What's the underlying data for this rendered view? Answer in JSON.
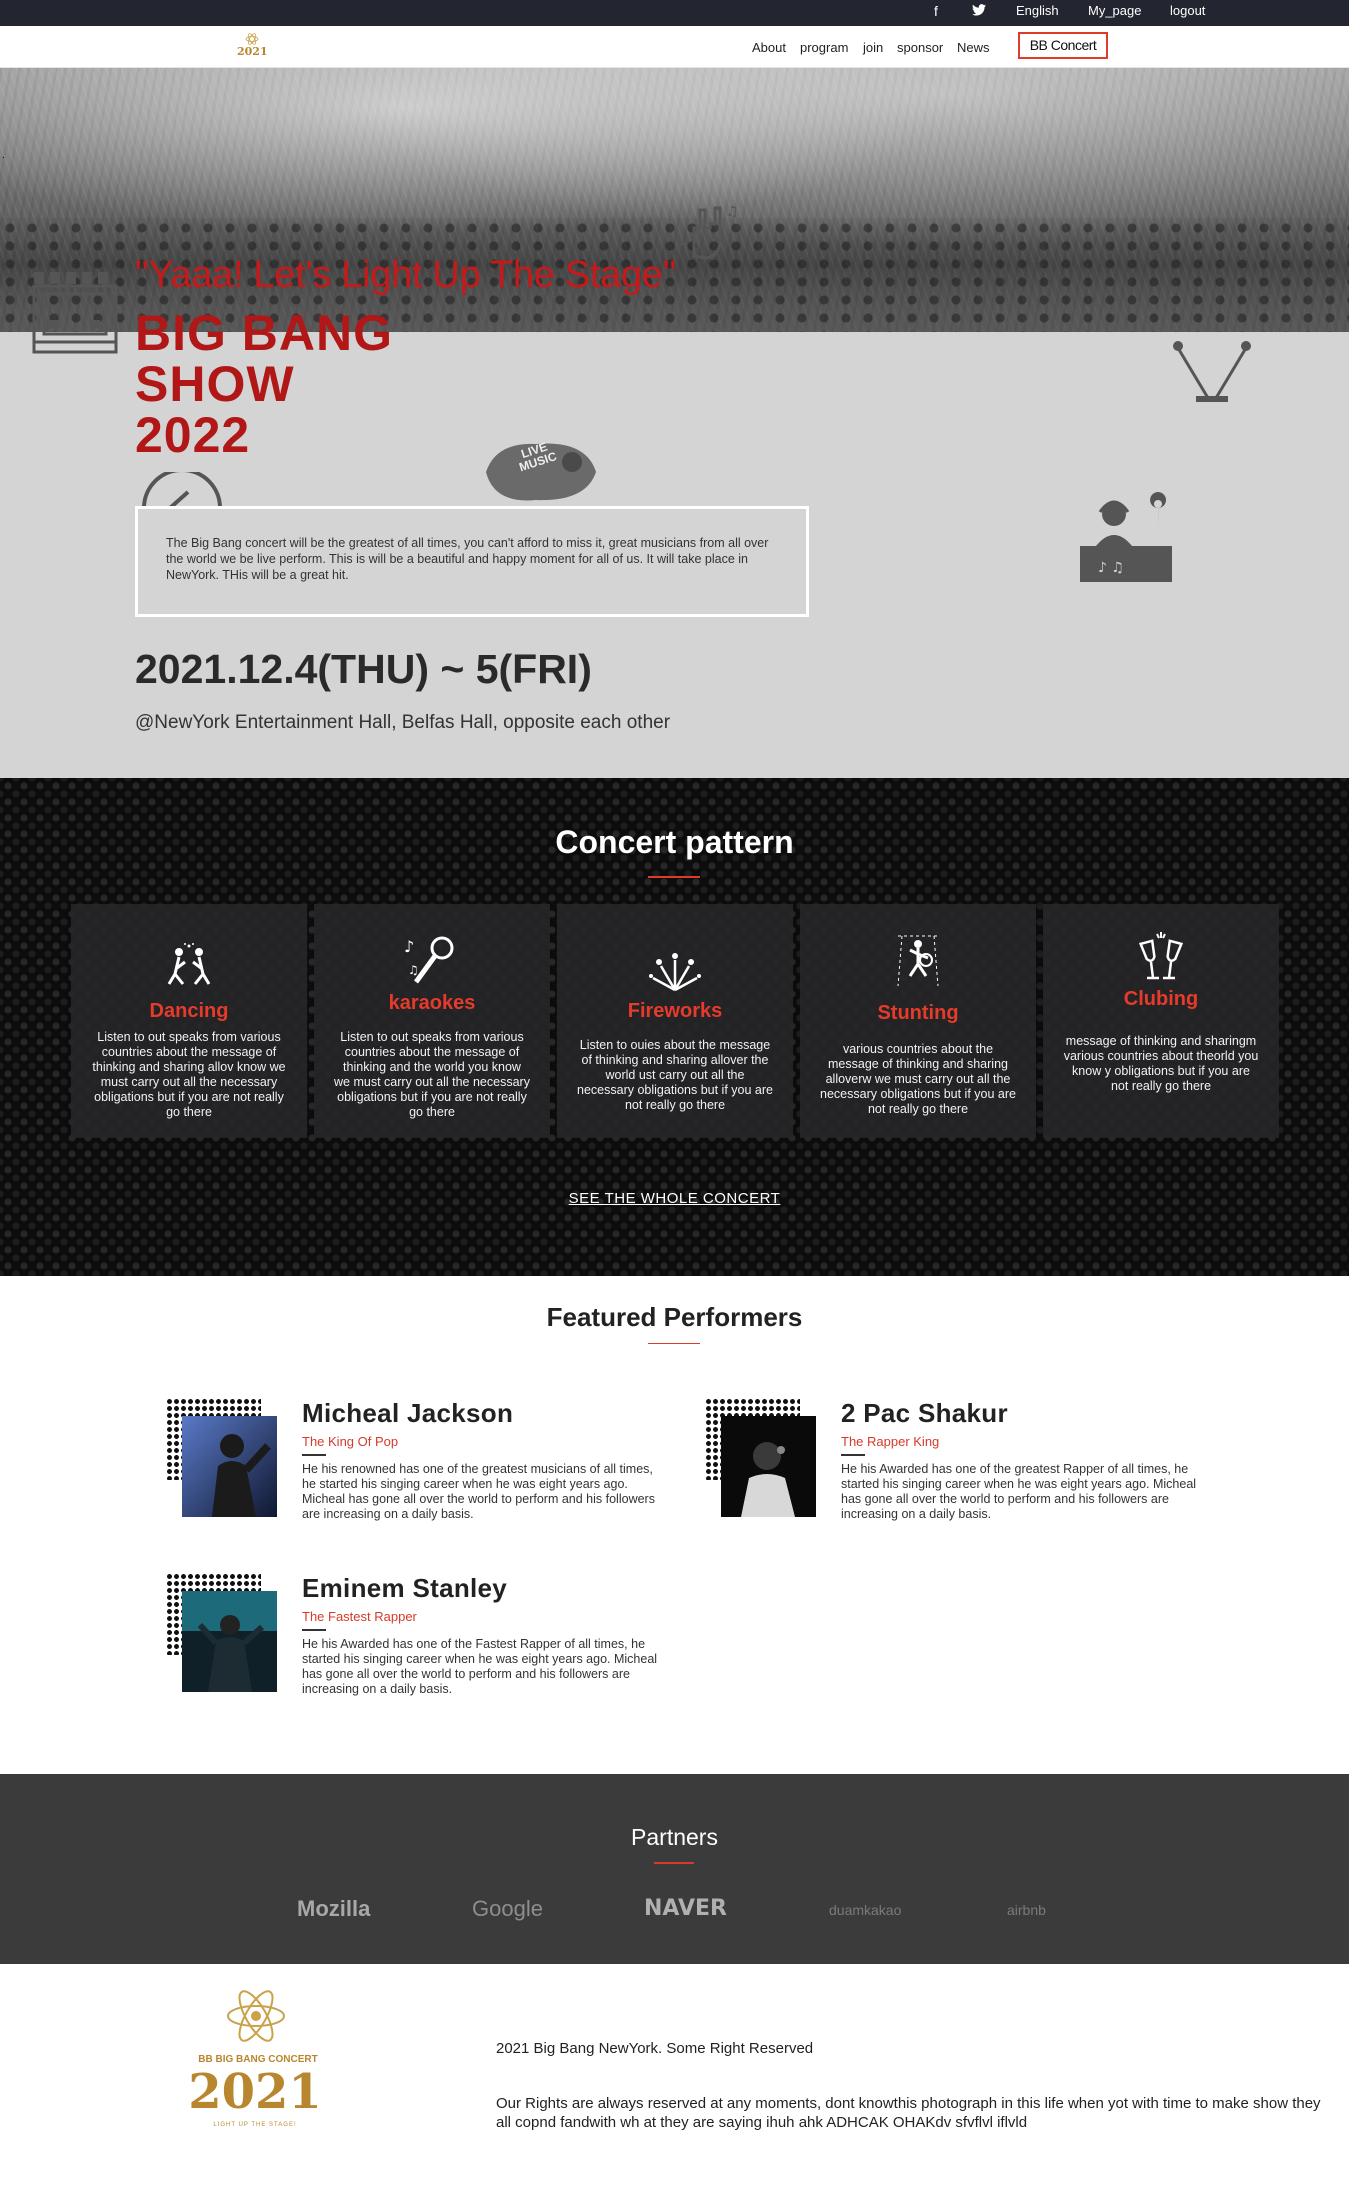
{
  "topbar": {
    "social": [
      {
        "icon": "facebook-icon",
        "glyph": "f"
      },
      {
        "icon": "twitter-icon",
        "glyph": "t"
      }
    ],
    "language": "English",
    "my_page": "My_page",
    "logout": "logout"
  },
  "nav": {
    "logo_text": "2021",
    "links": [
      "About",
      "program",
      "join",
      "sponsor",
      "News"
    ],
    "cta": "BB Concert"
  },
  "hero": {
    "tagline": "\"Yaaa! Let's Light Up The Stage\"",
    "title_lines": [
      "BIG BANG",
      "SHOW",
      "2022"
    ],
    "description": "The Big Bang concert will be the greatest of all times, you can't afford to miss it, great musicians from all over the world we be live perform. This is will be a beautiful and happy moment for all of us. It will take place in NewYork. THis will be a great hit.",
    "date": "2021.12.4(THU) ~ 5(FRI)",
    "venue": "@NewYork Entertainment Hall, Belfas Hall, opposite each other",
    "icon_badge_text": "LIVE MUSIC"
  },
  "pattern": {
    "heading": "Concert pattern",
    "cards": [
      {
        "name": "Dancing",
        "icon": "dancing-icon",
        "text": "Listen to out speaks from various countries about the message of thinking and sharing allov know we must carry out all the necessary obligations but if you are not really go there"
      },
      {
        "name": "karaokes",
        "icon": "karaoke-icon",
        "text": "Listen to out speaks from various countries about the message of thinking and the world you know we must carry out all the necessary obligations but if you are not really go there"
      },
      {
        "name": "Fireworks",
        "icon": "fireworks-icon",
        "text": "Listen to ouies about the message of thinking and sharing allover the world ust carry out all the necessary obligations but if you are not really go there"
      },
      {
        "name": "Stunting",
        "icon": "stunting-icon",
        "text": "various countries about the message of thinking and sharing alloverw we must carry out all the necessary obligations but if you are not really go there"
      },
      {
        "name": "Clubing",
        "icon": "clubing-icon",
        "text": "message of thinking and sharingm various countries about theorld you know y obligations but if you are not really go there"
      }
    ],
    "see_all": "SEE THE WHOLE CONCERT"
  },
  "performers": {
    "heading": "Featured Performers",
    "list": [
      {
        "name": "Micheal Jackson",
        "role": "The King Of Pop",
        "bio": "He his renowned has one of the greatest musicians of all times, he started his singing career when he was eight years ago. Micheal has gone all over the world to perform and his followers are increasing on a daily basis."
      },
      {
        "name": "2 Pac Shakur",
        "role": "The Rapper King",
        "bio": "He his Awarded has one of the greatest Rapper of all times, he started his singing career when he was eight years ago. Micheal has gone all over the world to perform and his followers are increasing on a daily basis."
      },
      {
        "name": "Eminem Stanley",
        "role": "The Fastest Rapper",
        "bio": "He his Awarded has one of the Fastest Rapper of all times, he started his singing career when he was eight years ago. Micheal has gone all over the world to perform and his followers are increasing on a daily basis."
      }
    ]
  },
  "partners": {
    "heading": "Partners",
    "brands": [
      "Mozilla",
      "Google",
      "NAVER",
      "duamkakao",
      "airbnb"
    ]
  },
  "footer": {
    "logo_line1": "BB BIG BANG CONCERT",
    "logo_year": "2021",
    "logo_line2": "LIGHT UP THE STAGE!",
    "copyright": "2021 Big Bang NewYork. Some Right Reserved",
    "rights": "Our Rights are always reserved at any moments, dont knowthis photograph in this life when yot with time to make show they all copnd fandwith wh at they are saying ihuh ahk ADHCAK OHAKdv sfvflvl iflvld"
  },
  "colors": {
    "accent": "#e03a2a",
    "title_red": "#b11717",
    "topbar": "#232630",
    "hero_bg": "#d4d4d4",
    "partners_bg": "#3b3b3b"
  }
}
